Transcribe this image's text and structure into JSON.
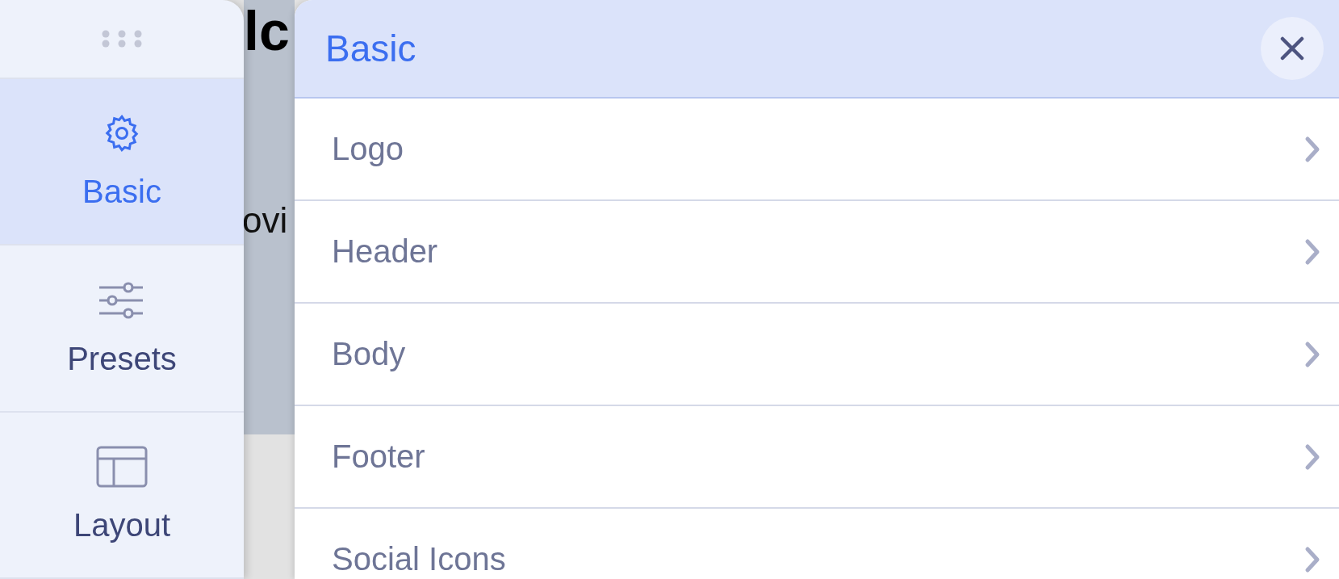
{
  "background_page": {
    "heading": "lc",
    "text": "ovi"
  },
  "sidebar": {
    "items": [
      {
        "label": "Basic",
        "kind": "gear",
        "selected": true
      },
      {
        "label": "Presets",
        "kind": "sliders",
        "selected": false
      },
      {
        "label": "Layout",
        "kind": "layout",
        "selected": false
      }
    ]
  },
  "panel": {
    "title": "Basic",
    "rows": [
      {
        "label": "Logo"
      },
      {
        "label": "Header"
      },
      {
        "label": "Body"
      },
      {
        "label": "Footer"
      },
      {
        "label": "Social Icons"
      }
    ]
  }
}
